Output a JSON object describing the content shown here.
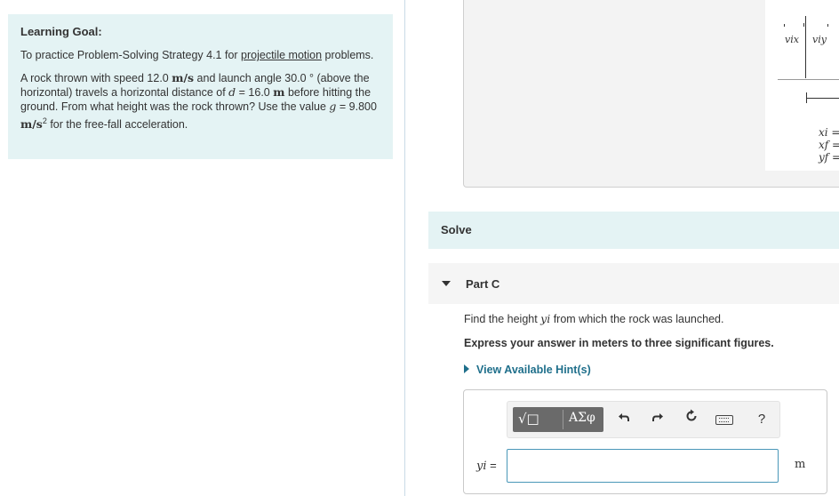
{
  "learning_goal": {
    "title": "Learning Goal:",
    "intro_prefix": "To practice Problem-Solving Strategy 4.1 for ",
    "intro_link": "projectile motion",
    "intro_suffix": " problems.",
    "problem_1": "A rock thrown with speed 12.0 ",
    "unit_ms": "m/s",
    "problem_2": " and launch angle 30.0 ° (above the horizontal) travels a horizontal distance of ",
    "var_d": "d",
    "problem_3": " = 16.0 ",
    "unit_m": "m",
    "problem_4": " before hitting the ground. From what height was the rock thrown? Use the value ",
    "var_g": "g",
    "problem_5": " = 9.800 ",
    "unit_ms2": "m/s",
    "unit_ms2_exp": "2",
    "problem_6": " for the free-fall acceleration."
  },
  "figure": {
    "col_vix": "vix",
    "col_viy": "viy",
    "eq_xi": "xi =",
    "eq_xf": "xf =",
    "eq_yf": "yf ="
  },
  "solve": {
    "label": "Solve"
  },
  "part": {
    "label": "Part C",
    "question_prefix": "Find the height ",
    "question_var": "yi",
    "question_suffix": " from which the rock was launched.",
    "instruction": "Express your answer in meters to three significant figures.",
    "hint_link": "View Available Hint(s)"
  },
  "toolbar": {
    "templates_icon": "√□",
    "greek_label": "ΑΣφ",
    "undo_icon": "undo-icon",
    "redo_icon": "redo-icon",
    "reset_icon": "reset-icon",
    "keyboard_icon": "keyboard-icon",
    "help_label": "?"
  },
  "answer": {
    "label_var": "yi",
    "label_eq": " =",
    "value": "",
    "unit": "m"
  }
}
